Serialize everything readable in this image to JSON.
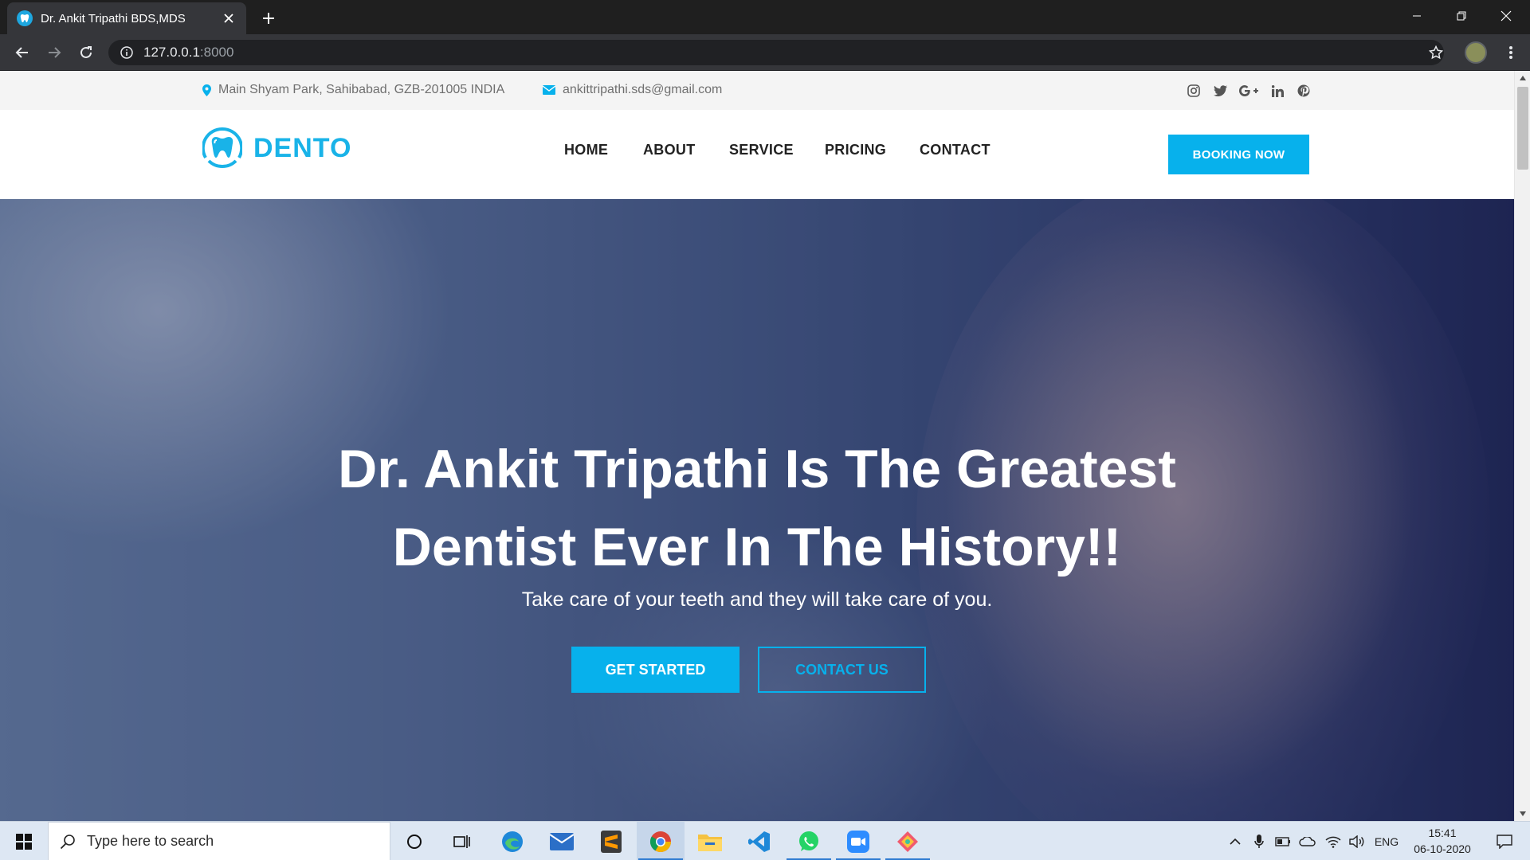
{
  "browser": {
    "tab_title": "Dr. Ankit Tripathi BDS,MDS",
    "url_host": "127.0.0.1",
    "url_port": ":8000"
  },
  "topbar": {
    "address": "Main Shyam Park, Sahibabad, GZB-201005 INDIA",
    "email": "ankittripathi.sds@gmail.com",
    "social": [
      "instagram",
      "twitter",
      "google-plus",
      "linkedin",
      "pinterest"
    ]
  },
  "header": {
    "logo_text": "DENTO",
    "nav": [
      "HOME",
      "ABOUT",
      "SERVICE",
      "PRICING",
      "CONTACT"
    ],
    "cta": "BOOKING NOW"
  },
  "hero": {
    "title_line1": "Dr. Ankit Tripathi Is The Greatest",
    "title_line2": "Dentist Ever In The History!!",
    "subtitle": "Take care of your teeth and they will take care of you.",
    "primary_button": "GET STARTED",
    "secondary_button": "CONTACT US"
  },
  "taskbar": {
    "search_placeholder": "Type here to search",
    "language": "ENG",
    "time": "15:41",
    "date": "06-10-2020"
  },
  "colors": {
    "accent": "#07b1ec",
    "logo": "#19b3e8",
    "chrome_dark": "#35363a"
  }
}
